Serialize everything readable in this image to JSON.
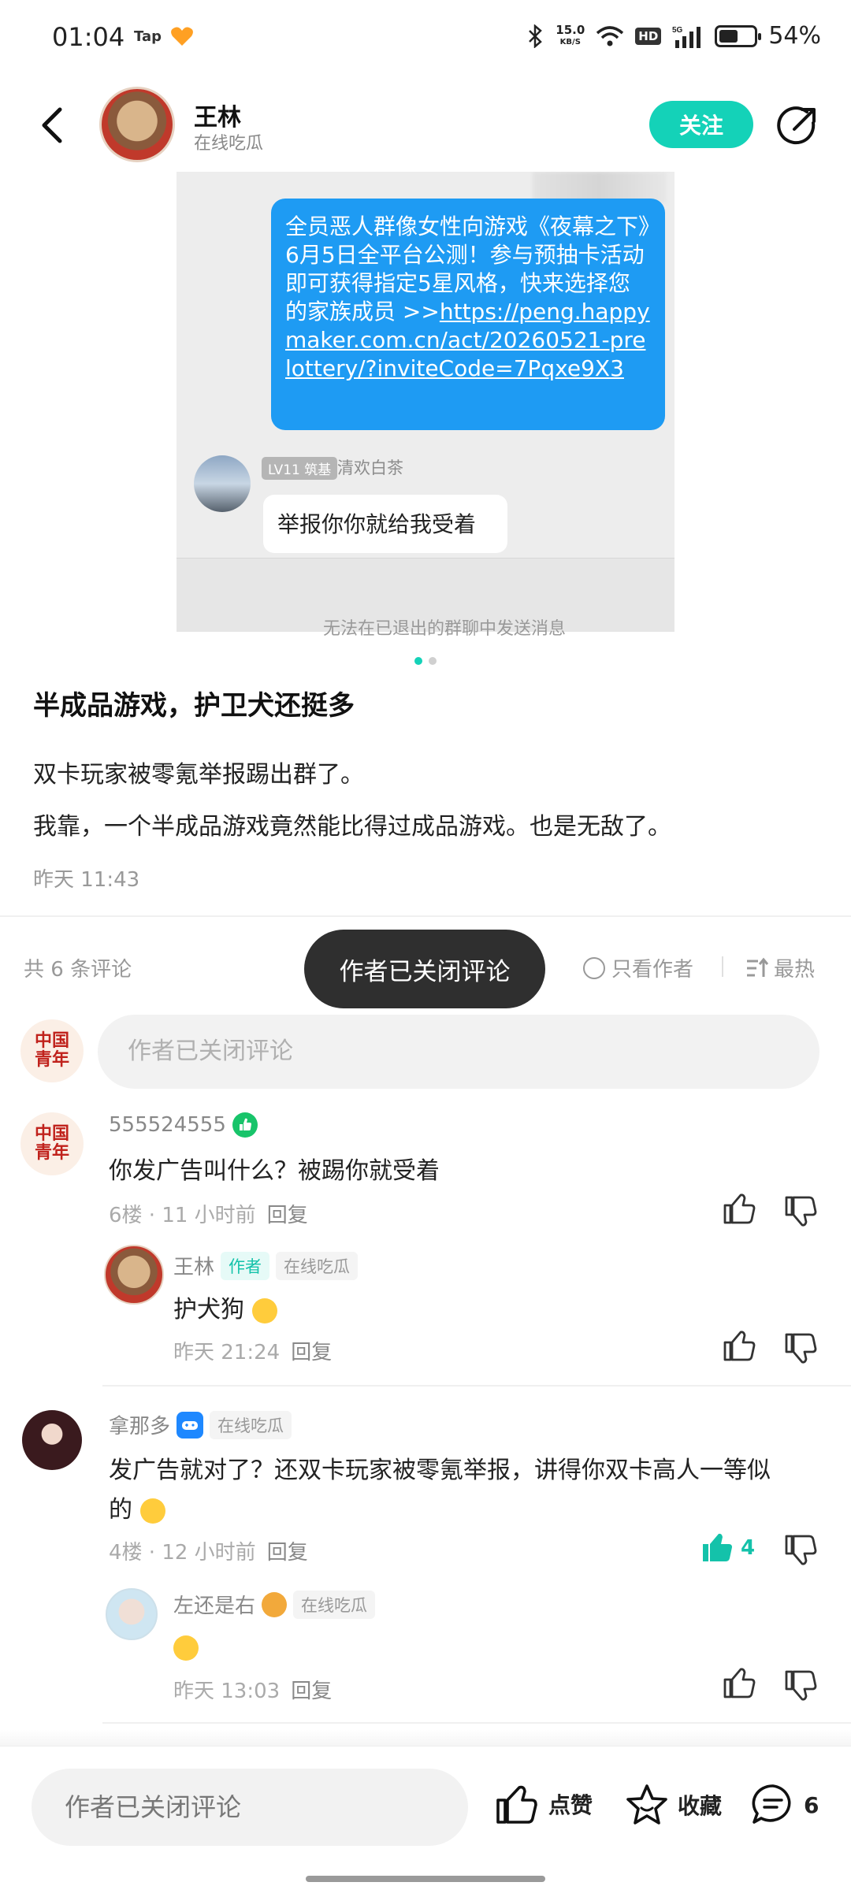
{
  "status_bar": {
    "time": "01:04",
    "tap_label": "Tap",
    "speed_top": "15.0",
    "speed_unit": "KB/S",
    "hd": "HD",
    "network": "5G",
    "battery": "54%",
    "battery_level": 0.54
  },
  "header": {
    "author_name": "王林",
    "author_status": "在线吃瓜",
    "follow_label": "关注"
  },
  "screenshot": {
    "message": "全员恶人群像女性向游戏《夜幕之下》6月5日全平台公测！参与预抽卡活动即可获得指定5星风格，快来选择您的家族成员",
    "link_prefix": ">>",
    "link": "https://peng.happymaker.com.cn/act/20260521-prelottery/?inviteCode=7Pqxe9X3",
    "level_badge": "LV11 筑基",
    "reply_name": "清欢白茶",
    "reply_text": "举报你你就给我受着",
    "footer_text": "无法在已退出的群聊中发送消息"
  },
  "post": {
    "title": "半成品游戏，护卫犬还挺多",
    "line1": "双卡玩家被零氪举报踢出群了。",
    "line2": "我靠，一个半成品游戏竟然能比得过成品游戏。也是无敌了。",
    "time": "昨天 11:43"
  },
  "comments_bar": {
    "count": "共 6 条评论",
    "toast": "作者已关闭评论",
    "only_author": "只看作者",
    "sort": "最热",
    "input_placeholder": "作者已关闭评论"
  },
  "comments": [
    {
      "name": "555524555",
      "text": "你发广告叫什么？被踢你就受着",
      "meta": "6楼 · 11 小时前",
      "reply_label": "回复",
      "reply": {
        "name": "王林",
        "author_tag": "作者",
        "tag": "在线吃瓜",
        "text": "护犬狗",
        "meta": "昨天 21:24",
        "reply_label": "回复"
      }
    },
    {
      "name": "拿那多",
      "tag": "在线吃瓜",
      "text_line1": "发广告就对了？还双卡玩家被零氪举报，讲得你双卡高人一等似",
      "text_line2": "的",
      "meta": "4楼 · 12 小时前",
      "reply_label": "回复",
      "likes": "4",
      "reply": {
        "name": "左还是右",
        "tag": "在线吃瓜",
        "meta": "昨天 13:03",
        "reply_label": "回复"
      }
    }
  ],
  "bottom_bar": {
    "input_placeholder": "作者已关闭评论",
    "like_label": "点赞",
    "fav_label": "收藏",
    "comment_count": "6"
  },
  "colors": {
    "accent": "#14d2b8",
    "toast_bg": "#2f2f2f",
    "bubble_blue": "#1e9bf3"
  },
  "icons": [
    "back-arrow-icon",
    "share-icon",
    "thumbs-up-icon",
    "thumbs-down-icon",
    "star-icon",
    "comment-icon",
    "verified-icon",
    "gamepad-icon",
    "sort-icon"
  ]
}
